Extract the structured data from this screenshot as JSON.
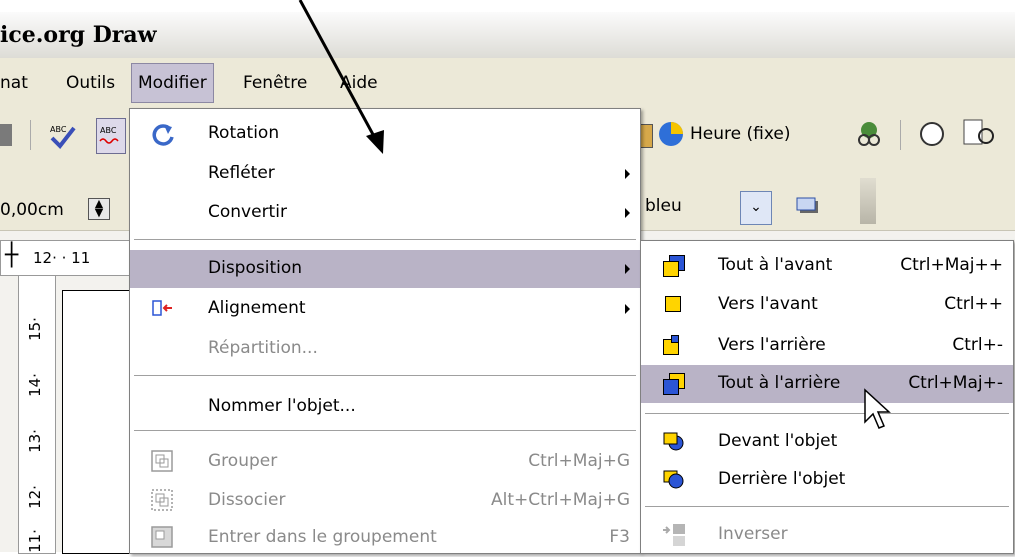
{
  "window": {
    "title": "ice.org Draw"
  },
  "menubar": {
    "items": [
      {
        "label": "nat"
      },
      {
        "label": "Outils"
      },
      {
        "label": "Modifier"
      },
      {
        "label": "Fenêtre"
      },
      {
        "label": "Aide"
      }
    ]
  },
  "toolbar": {
    "heure_label": "Heure (fixe)",
    "width_value": "0,00cm",
    "color_value": "bleu"
  },
  "ruler": {
    "h_ticks": "12· · 11",
    "v_ticks": [
      "15·",
      "14·",
      "13·",
      "12·",
      "11·"
    ]
  },
  "modifier_menu": {
    "items": [
      {
        "label": "Rotation"
      },
      {
        "label": "Refléter"
      },
      {
        "label": "Convertir"
      },
      {
        "label": "Disposition"
      },
      {
        "label": "Alignement"
      },
      {
        "label": "Répartition..."
      },
      {
        "label": "Nommer l'objet..."
      },
      {
        "label": "Grouper",
        "shortcut": "Ctrl+Maj+G"
      },
      {
        "label": "Dissocier",
        "shortcut": "Alt+Ctrl+Maj+G"
      },
      {
        "label": "Entrer dans le groupement",
        "shortcut": "F3"
      }
    ]
  },
  "disposition_menu": {
    "items": [
      {
        "label": "Tout à l'avant",
        "shortcut": "Ctrl+Maj++"
      },
      {
        "label": "Vers l'avant",
        "shortcut": "Ctrl++"
      },
      {
        "label": "Vers l'arrière",
        "shortcut": "Ctrl+-"
      },
      {
        "label": "Tout à l'arrière",
        "shortcut": "Ctrl+Maj+-"
      },
      {
        "label": "Devant l'objet"
      },
      {
        "label": "Derrière l'objet"
      },
      {
        "label": "Inverser"
      }
    ]
  },
  "colors": {
    "highlight": "#b9b3c6",
    "menubar": "#ece9d8",
    "disabled": "#8a8a8a"
  }
}
